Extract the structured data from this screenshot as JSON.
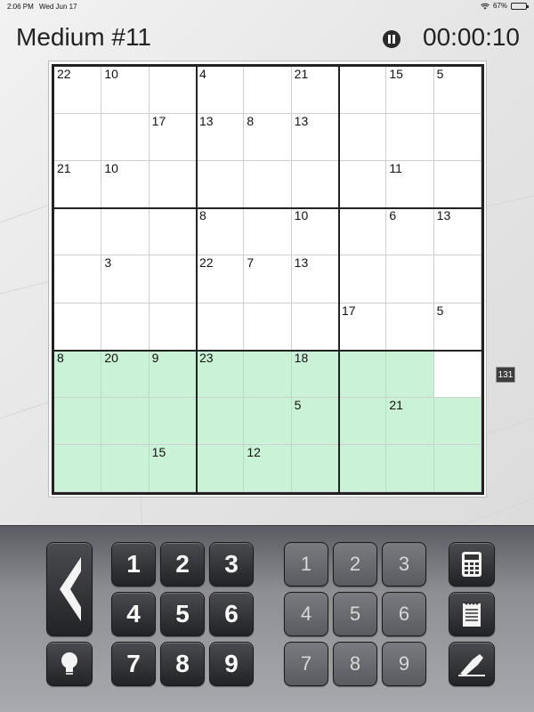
{
  "status_bar": {
    "time": "2:06 PM",
    "date": "Wed Jun 17",
    "battery": "67%",
    "battery_level": 0.67
  },
  "header": {
    "title": "Medium #11",
    "timer": "00:00:10"
  },
  "board": {
    "size": 9,
    "cage_sums": [
      {
        "row": 0,
        "col": 0,
        "sum": "22"
      },
      {
        "row": 0,
        "col": 1,
        "sum": "10"
      },
      {
        "row": 0,
        "col": 3,
        "sum": "4"
      },
      {
        "row": 0,
        "col": 5,
        "sum": "21"
      },
      {
        "row": 0,
        "col": 7,
        "sum": "15"
      },
      {
        "row": 0,
        "col": 8,
        "sum": "5"
      },
      {
        "row": 1,
        "col": 2,
        "sum": "17"
      },
      {
        "row": 1,
        "col": 3,
        "sum": "13"
      },
      {
        "row": 1,
        "col": 4,
        "sum": "8"
      },
      {
        "row": 1,
        "col": 5,
        "sum": "13"
      },
      {
        "row": 2,
        "col": 0,
        "sum": "21"
      },
      {
        "row": 2,
        "col": 1,
        "sum": "10"
      },
      {
        "row": 2,
        "col": 7,
        "sum": "11"
      },
      {
        "row": 3,
        "col": 3,
        "sum": "8"
      },
      {
        "row": 3,
        "col": 5,
        "sum": "10"
      },
      {
        "row": 3,
        "col": 7,
        "sum": "6"
      },
      {
        "row": 3,
        "col": 8,
        "sum": "13"
      },
      {
        "row": 4,
        "col": 1,
        "sum": "3"
      },
      {
        "row": 4,
        "col": 3,
        "sum": "22"
      },
      {
        "row": 4,
        "col": 4,
        "sum": "7"
      },
      {
        "row": 4,
        "col": 5,
        "sum": "13"
      },
      {
        "row": 5,
        "col": 6,
        "sum": "17"
      },
      {
        "row": 5,
        "col": 8,
        "sum": "5"
      },
      {
        "row": 6,
        "col": 0,
        "sum": "8"
      },
      {
        "row": 6,
        "col": 1,
        "sum": "20"
      },
      {
        "row": 6,
        "col": 2,
        "sum": "9"
      },
      {
        "row": 6,
        "col": 3,
        "sum": "23"
      },
      {
        "row": 6,
        "col": 5,
        "sum": "18"
      },
      {
        "row": 7,
        "col": 5,
        "sum": "5"
      },
      {
        "row": 7,
        "col": 7,
        "sum": "21"
      },
      {
        "row": 8,
        "col": 2,
        "sum": "15"
      },
      {
        "row": 8,
        "col": 4,
        "sum": "12"
      }
    ],
    "highlight_color": "#c9f2d6",
    "white_cells_in_highlight": [
      [
        6,
        8
      ]
    ]
  },
  "side_badge": "131",
  "keypad": {
    "numbers": [
      "1",
      "2",
      "3",
      "4",
      "5",
      "6",
      "7",
      "8",
      "9"
    ],
    "candidate_numbers": [
      "1",
      "2",
      "3",
      "4",
      "5",
      "6",
      "7",
      "8",
      "9"
    ],
    "icons": {
      "back": "back-arrow-icon",
      "hint": "lightbulb-icon",
      "calculator": "calculator-icon",
      "notes": "notepad-icon",
      "eraser": "eraser-icon"
    }
  }
}
